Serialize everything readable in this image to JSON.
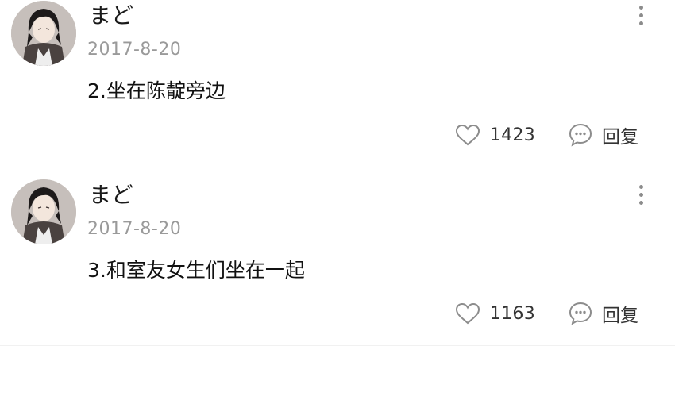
{
  "comments": [
    {
      "username": "まど",
      "date": "2017-8-20",
      "text": "2.坐在陈靛旁边",
      "likes": "1423",
      "reply_label": "回复"
    },
    {
      "username": "まど",
      "date": "2017-8-20",
      "text": "3.和室友女生们坐在一起",
      "likes": "1163",
      "reply_label": "回复"
    }
  ],
  "icons": {
    "like": "heart-icon",
    "reply": "speech-bubble-icon",
    "more": "more-vertical-icon"
  },
  "colors": {
    "text": "#111111",
    "meta": "#9a9a9a",
    "icon": "#8c8c8c"
  }
}
